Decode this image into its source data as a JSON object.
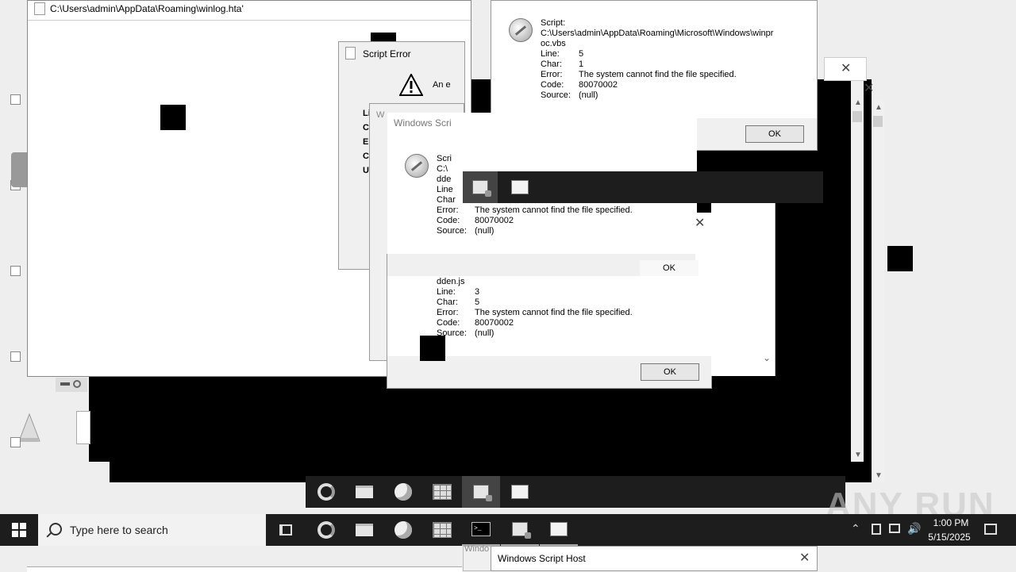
{
  "hta_window": {
    "title": "C:\\Users\\admin\\AppData\\Roaming\\winlog.hta'"
  },
  "script_error": {
    "title": "Script Error",
    "message_fragment": "An e",
    "labels": [
      "Li",
      "C",
      "E",
      "C",
      "U"
    ]
  },
  "wsh_partial_title": "W",
  "wsh_top": {
    "script_label": "Script:",
    "script_path_1": "C:\\Users\\admin\\AppData\\Roaming\\Microsoft\\Windows\\winpr",
    "script_path_2": "oc.vbs",
    "line_label": "Line:",
    "line": "5",
    "char_label": "Char:",
    "char": "1",
    "error_label": "Error:",
    "error": "The system cannot find the file specified.",
    "code_label": "Code:",
    "code": "80070002",
    "source_label": "Source:",
    "source": "(null)",
    "ok": "OK"
  },
  "wsh_mid": {
    "title": "Windows Scri",
    "script_label": "Scri",
    "path_frag_1": "C:\\",
    "path_frag_2": "dde",
    "line_label": "Line",
    "char_label": "Char",
    "error_label": "Error:",
    "error": "The system cannot find the file specified.",
    "code_label": "Code:",
    "code": "80070002",
    "source_label": "Source:",
    "source": "(null)",
    "ok": "OK"
  },
  "wsh_low": {
    "path_tail": "dden.js",
    "line_label": "Line:",
    "line": "3",
    "char_label": "Char:",
    "char": "5",
    "error_label": "Error:",
    "error": "The system cannot find the file specified.",
    "code_label": "Code:",
    "code": "80070002",
    "source_label": "Source:",
    "source": "(null)",
    "ok": "OK"
  },
  "bottom_wsh": {
    "title": "Windows Script Host",
    "partial_title": "Windo"
  },
  "taskbar": {
    "search_placeholder": "Type here to search",
    "time": "1:00 PM",
    "date": "5/15/2025",
    "pinned": [
      "task-view-icon",
      "edge-icon",
      "file-explorer-icon",
      "firefox-icon",
      "app-grid-icon",
      "cmd-icon",
      "script-host-icon",
      "document-icon"
    ]
  },
  "watermark": "ANY RUN"
}
